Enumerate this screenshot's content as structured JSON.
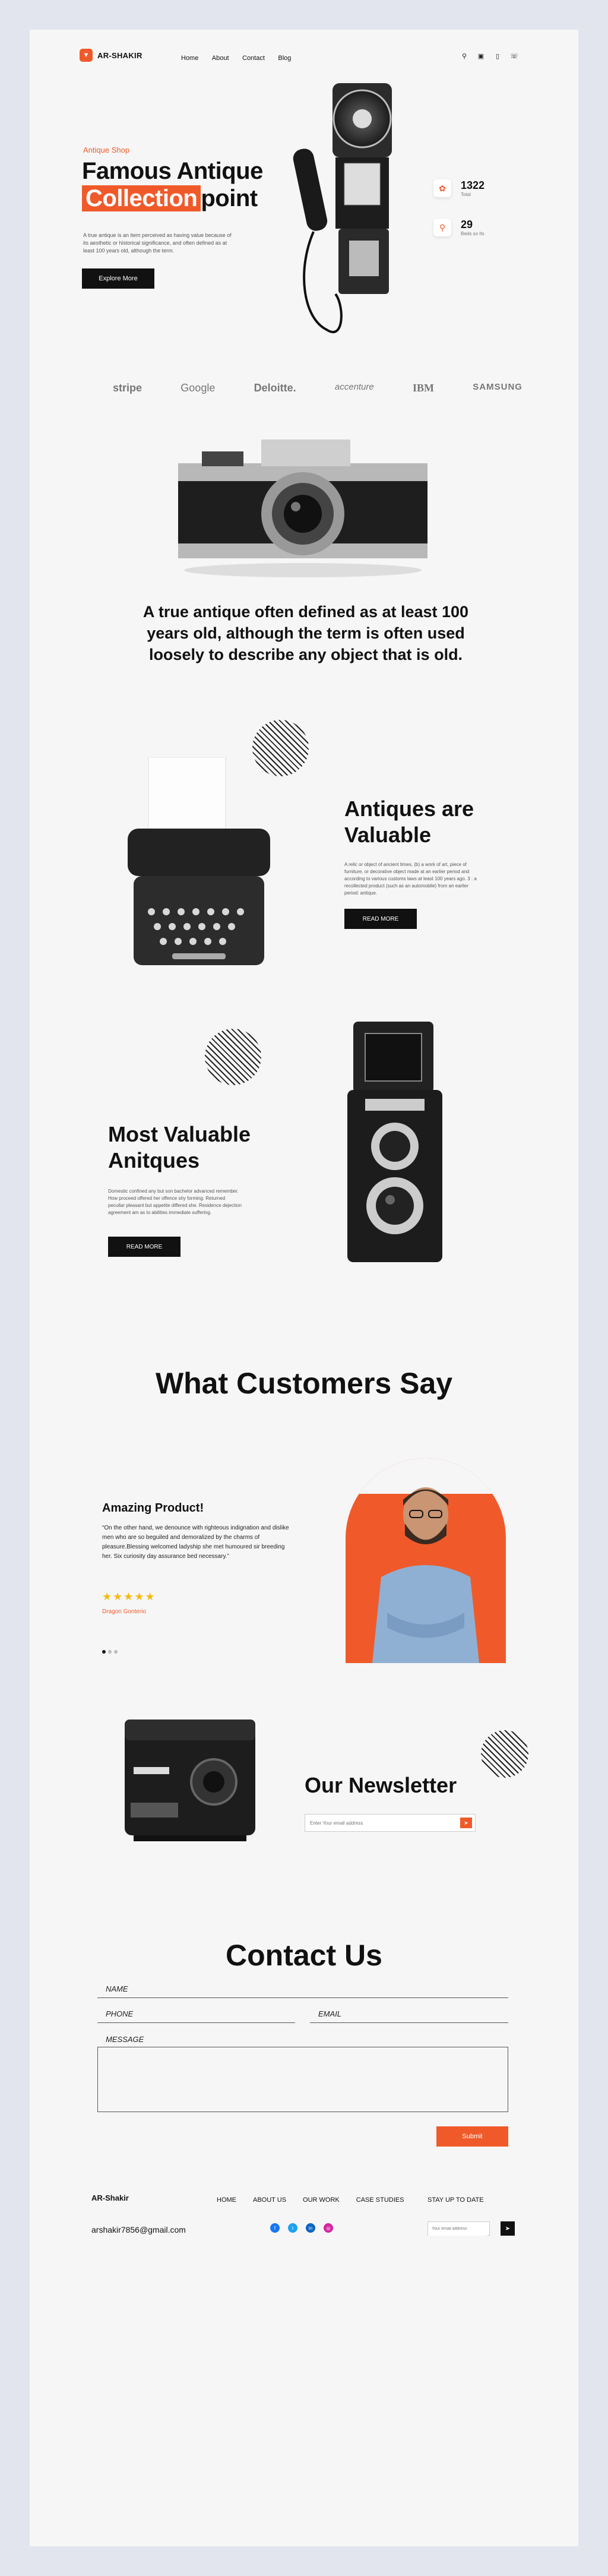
{
  "header": {
    "brand": "AR-SHAKIR",
    "nav": [
      "Home",
      "About",
      "Contact",
      "Blog"
    ],
    "icons": [
      "search-icon",
      "bag-icon",
      "bookmark-icon",
      "whatsapp-icon"
    ]
  },
  "hero": {
    "kicker": "Antique Shop",
    "title_line1": "Famous Antique",
    "title_highlight": "Collection",
    "title_end": "point",
    "desc": "A true antique is an item perceived as having value because of its aesthetic or historical significance, and often defined as at least 100 years old, although the term.",
    "cta": "Explore More",
    "stats": [
      {
        "num": "1322",
        "label": "Total"
      },
      {
        "num": "29",
        "label": "Beds so Its"
      }
    ]
  },
  "partners": [
    "stripe",
    "Google",
    "Deloitte.",
    "accenture",
    "IBM",
    "SAMSUNG"
  ],
  "quote": "A true antique often defined as at least 100 years old, although the term is often used loosely to describe any object that is old.",
  "valuable": {
    "title_line1": "Antiques are",
    "title_line2": "Valuable",
    "desc": "A relic or object of ancient times, (b) a work of art, piece of furniture, or decorative object made at an earlier period and according to various customs laws at least 100 years ago. 3 : a recollected product (such as an automobile) from an earlier period: antique.",
    "cta": "READ MORE"
  },
  "most_valuable": {
    "title_line1": "Most Valuable",
    "title_line2": "Anitques",
    "desc": "Domestic confined any but son bachelor advanced remember. How proceed offered her offence shy forming. Returned peculiar pleasant but appetite differed she. Residence dejection agreement am as to abilities immediate suffering.",
    "cta": "READ MORE"
  },
  "testimonial": {
    "section_title": "What Customers Say",
    "title": "Amazing Product!",
    "text": "“On the other hand, we denounce with righteous indignation and dislike men who are so beguiled and demoralized by the charms of pleasure.Blessing welcomed ladyship she met humoured sir breeding her. Six curiosity day assurance bed necessary.”",
    "stars": "★★★★★",
    "author": "Dragon Gonterio"
  },
  "newsletter": {
    "title": "Our Newsletter",
    "placeholder": "Enter Your email address"
  },
  "contact": {
    "title": "Contact  Us",
    "name": "NAME",
    "phone": "PHONE",
    "email": "EMAIL",
    "message": "MESSAGE",
    "submit": "Submit"
  },
  "footer": {
    "brand": "AR-Shakir",
    "email": "arshakir7856@gmail.com",
    "links": [
      "HOME",
      "ABOUT US",
      "OUR WORK",
      "CASE STUDIES"
    ],
    "stay": "STAY UP TO DATE",
    "placeholder": "Your email address",
    "socials": [
      {
        "icon": "facebook-icon",
        "glyph": "f",
        "color": "#1877f2"
      },
      {
        "icon": "twitter-icon",
        "glyph": "t",
        "color": "#1da1f2"
      },
      {
        "icon": "linkedin-icon",
        "glyph": "in",
        "color": "#0a66c2"
      },
      {
        "icon": "instagram-icon",
        "glyph": "◎",
        "color": "#d6249f"
      }
    ]
  }
}
